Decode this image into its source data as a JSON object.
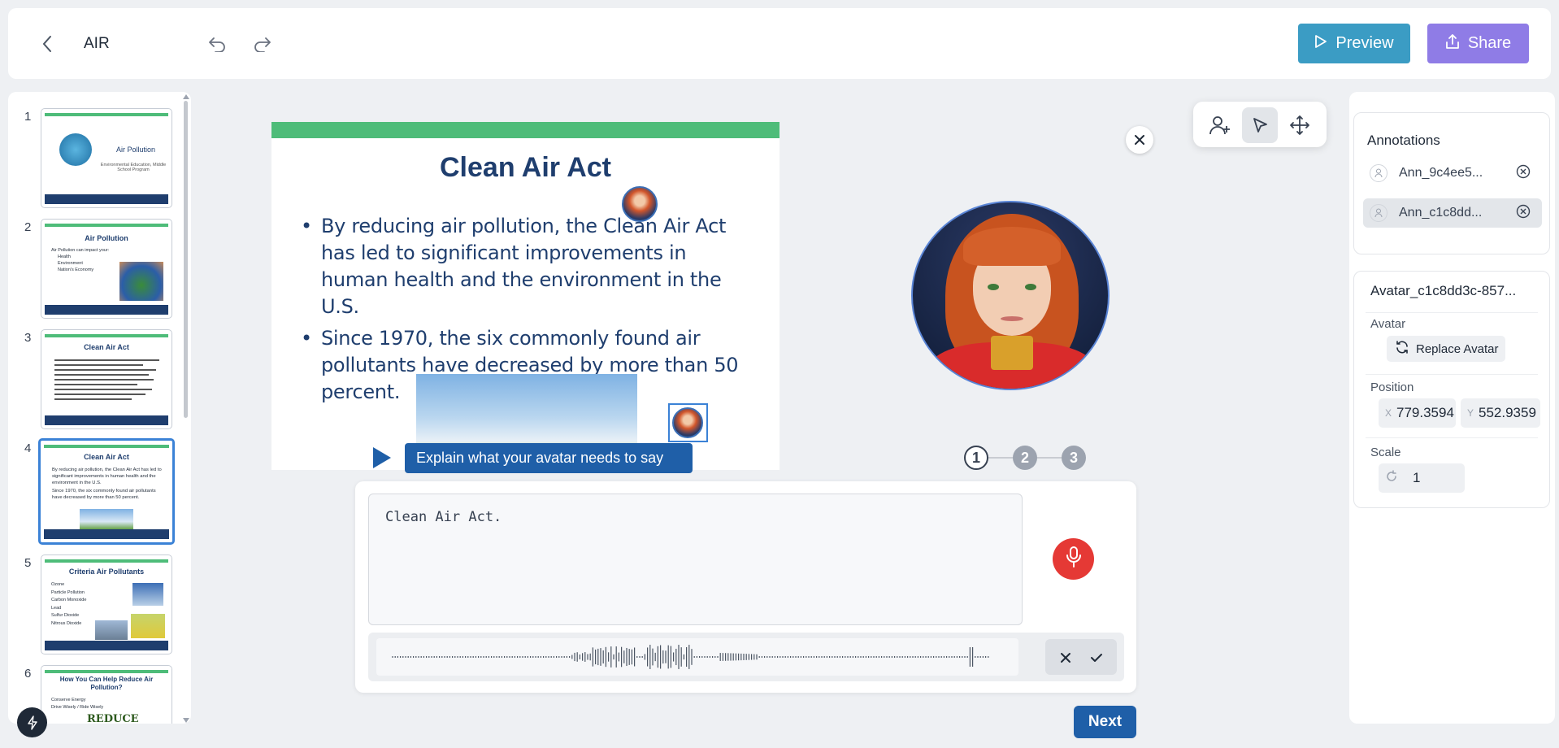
{
  "header": {
    "title": "AIR",
    "preview_label": "Preview",
    "share_label": "Share"
  },
  "thumbnails": [
    {
      "num": "1",
      "title": "Air Pollution",
      "sub": "Environmental Education, Middle School Program"
    },
    {
      "num": "2",
      "title": "Air Pollution",
      "lines": [
        "Air Pollution can impact your:",
        "Health",
        "Environment",
        "Nation's Economy"
      ]
    },
    {
      "num": "3",
      "title": "Clean Air Act"
    },
    {
      "num": "4",
      "title": "Clean Air Act",
      "lines": [
        "By reducing air pollution, the Clean Air Act has led to significant improvements in human health and the environment in the U.S.",
        "Since 1970, the six commonly found air pollutants have decreased by more than 50 percent."
      ]
    },
    {
      "num": "5",
      "title": "Criteria Air Pollutants",
      "lines": [
        "Ozone",
        "Particle Pollution",
        "Carbon Monoxide",
        "Lead",
        "Sulfur Dioxide",
        "Nitrous Dioxide"
      ]
    },
    {
      "num": "6",
      "title": "How You Can Help Reduce Air Pollution?",
      "lines": [
        "Conserve Energy",
        "Drive Wisely / Ride Wisely"
      ],
      "badge": "REDUCE"
    }
  ],
  "slide": {
    "title": "Clean Air Act",
    "bullets": [
      "By reducing air pollution, the Clean Air Act has led to significant improvements in human health and the environment in the U.S.",
      "Since 1970, the six commonly found air pollutants have decreased by more than 50 percent."
    ]
  },
  "tooltip": "Explain what your avatar needs to say",
  "steps": [
    "1",
    "2",
    "3"
  ],
  "script_text": "Clean Air Act.",
  "next_label": "Next",
  "annotations": {
    "heading": "Annotations",
    "items": [
      "Ann_9c4ee5...",
      "Ann_c1c8dd..."
    ]
  },
  "properties": {
    "name": "Avatar_c1c8dd3c-857...",
    "avatar_label": "Avatar",
    "replace_label": "Replace Avatar",
    "position_label": "Position",
    "x_key": "X",
    "x_value": "779.3594",
    "y_key": "Y",
    "y_value": "552.9359",
    "scale_label": "Scale",
    "scale_value": "1"
  },
  "colors": {
    "accent_green": "#4ebc79",
    "slide_navy": "#1f3e6e",
    "preview_blue": "#3b9cc4",
    "share_purple": "#8f7ce6",
    "primary_blue": "#1f5fa8",
    "mic_red": "#e53935"
  }
}
